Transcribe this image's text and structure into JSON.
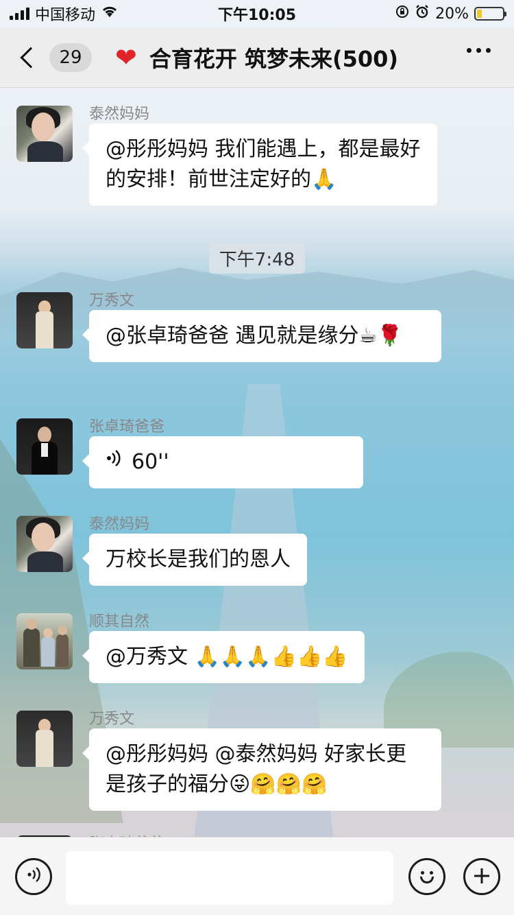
{
  "status_bar": {
    "carrier": "中国移动",
    "time": "下午10:05",
    "battery": "20%",
    "battery_level": 0.2
  },
  "nav": {
    "unread_count": "29",
    "title": "合育花开 筑梦未来(500)"
  },
  "messages": [
    {
      "sender": "泰然妈妈",
      "text": "@彤彤妈妈 我们能遇上，都是最好的安排！前世注定好的🙏"
    },
    {
      "time": "下午7:48"
    },
    {
      "sender": "万秀文",
      "text": "@张卓琦爸爸 遇见就是缘分☕🌹"
    },
    {
      "sender": "张卓琦爸爸",
      "voice": "60''"
    },
    {
      "sender": "泰然妈妈",
      "text": "万校长是我们的恩人"
    },
    {
      "sender": "顺其自然",
      "text": "@万秀文 🙏🙏🙏👍👍👍"
    },
    {
      "sender": "万秀文",
      "text": "@彤彤妈妈 @泰然妈妈 好家长更是孩子的福分😜🤗🤗🤗"
    },
    {
      "sender": "张卓琦爸爸"
    }
  ],
  "input": {
    "value": ""
  }
}
